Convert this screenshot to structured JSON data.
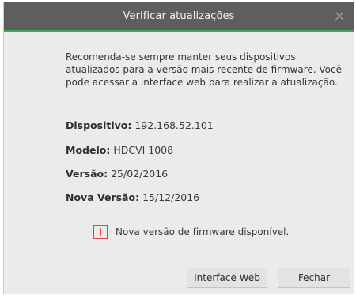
{
  "dialog": {
    "title": "Verificar atualizações",
    "close_glyph": "×",
    "message": "Recomenda-se sempre manter seus dispositivos atualizados para a versão mais recente de firmware. Você pode acessar a interface web para realizar a atualização."
  },
  "info": {
    "device_label": "Dispositivo:",
    "device_value": "192.168.52.101",
    "model_label": "Modelo:",
    "model_value": "HDCVI 1008",
    "version_label": "Versão:",
    "version_value": "25/02/2016",
    "new_version_label": "Nova Versão:",
    "new_version_value": "15/12/2016"
  },
  "notice": {
    "label": "Nova versão de firmware disponível."
  },
  "buttons": {
    "web_label": "Interface Web",
    "close_label": "Fechar"
  },
  "colors": {
    "titlebar": "#5e5e5e",
    "accent": "#3aa657",
    "background": "#ebebeb",
    "checkbox_border": "#e34848"
  }
}
